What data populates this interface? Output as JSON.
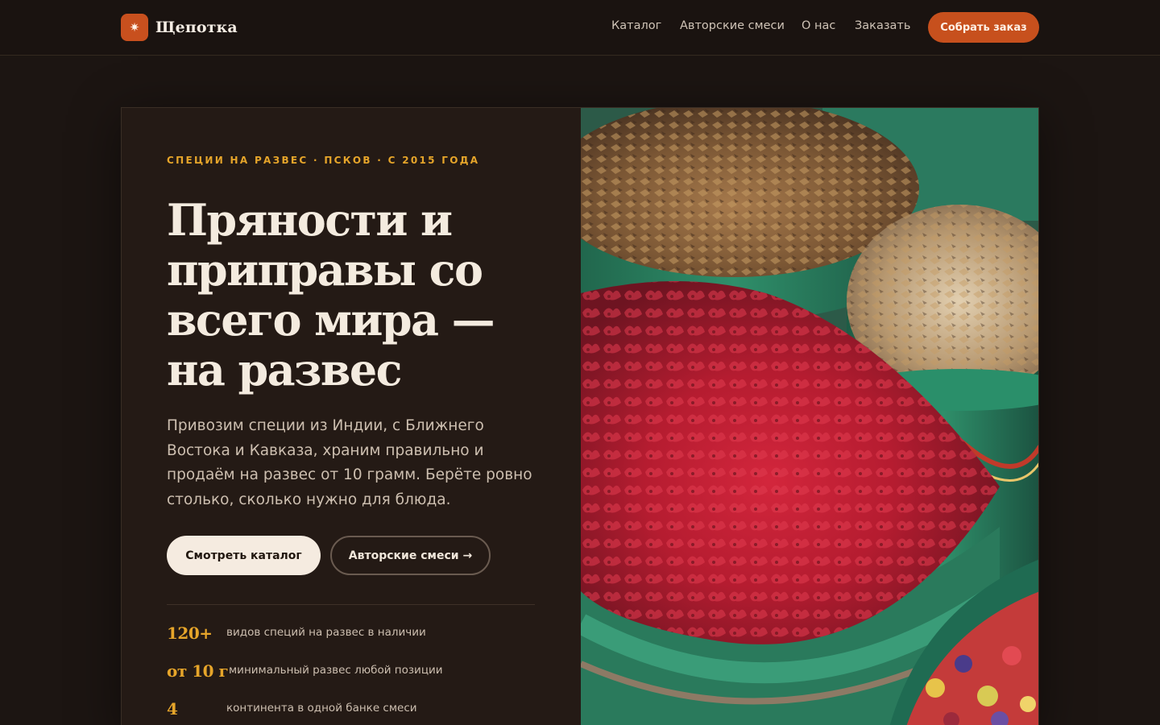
{
  "header": {
    "logo_symbol": "✷",
    "brand": "Щепотка",
    "nav": [
      "Каталог",
      "Авторские смеси",
      "О нас",
      "Заказать"
    ],
    "cta": "Собрать заказ"
  },
  "hero": {
    "eyebrow": "Специи на развес · Псков · с 2015 года",
    "title": "Пряности и приправы со всего мира — на развес",
    "lead": "Привозим специи из Индии, с Ближнего Востока и Кавказа, храним правильно и продаём на развес от 10 грамм. Берёте ровно столько, сколько нужно для блюда.",
    "btn_catalog": "Смотреть каталог",
    "btn_blends": "Авторские смеси →",
    "stats": [
      {
        "num": "120+",
        "label": "видов специй на развес в наличии"
      },
      {
        "num": "от 10 г",
        "label": "минимальный развес любой позиции"
      },
      {
        "num": "4",
        "label": "континента в одной банке смеси"
      }
    ]
  },
  "colors": {
    "accent": "#c7501d",
    "gold": "#e6a52a",
    "background": "#1c1512"
  }
}
